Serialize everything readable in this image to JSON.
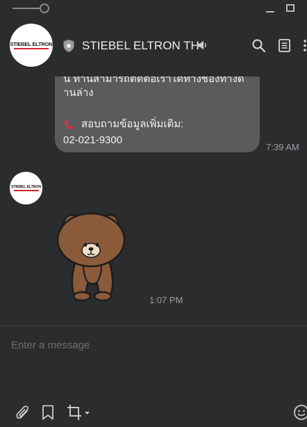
{
  "window": {
    "controls": [
      "minimize",
      "maximize"
    ]
  },
  "header": {
    "title": "STIEBEL ELTRON TH",
    "avatar_logo_text": "STIEBEL ELTRON",
    "icons": [
      "shield-star-icon",
      "speaker-icon",
      "search-icon",
      "note-icon",
      "more-icon"
    ]
  },
  "messages": [
    {
      "type": "text",
      "lines": [
        "น ท่านสามารถติดต่อเราได้ทางช่องทางด้",
        "านล่าง",
        "สอบถามข้อมูลเพิ่มเติม:",
        "02-021-9300"
      ],
      "time": "7:39 AM"
    },
    {
      "type": "sticker",
      "sender_logo_text": "STIEBEL ELTRON",
      "time": "1:07 PM"
    }
  ],
  "composer": {
    "placeholder": "Enter a message",
    "value": "",
    "toolbar": [
      "paperclip-icon",
      "bookmark-icon",
      "crop-icon",
      "emoji-icon"
    ]
  },
  "colors": {
    "background": "#2b2c2e",
    "bubble": "#5a5b5d",
    "brand_red": "#d2202f",
    "timestamp": "#9c9d9f"
  }
}
